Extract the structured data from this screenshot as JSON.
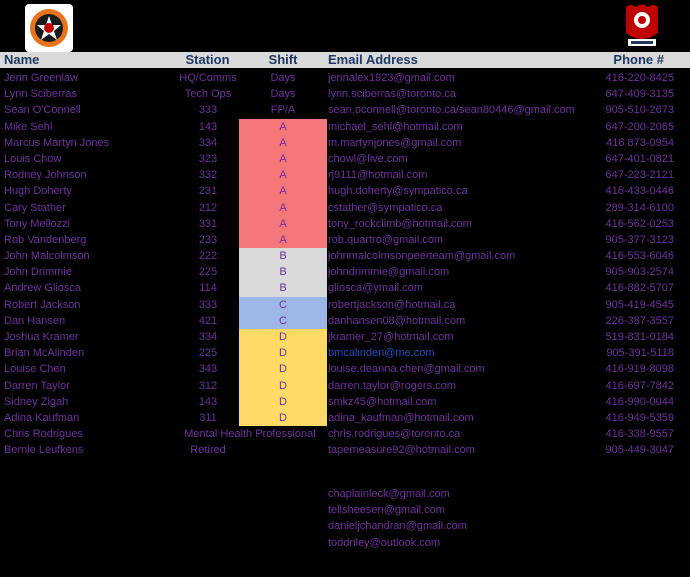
{
  "header": {
    "name": "Name",
    "station": "Station",
    "shift": "Shift",
    "email": "Email Address",
    "phone": "Phone #"
  },
  "colors": {
    "shift_a": "#f4777a",
    "shift_b": "#d9d9d9",
    "shift_c": "#9cb6e5",
    "shift_d": "#ffd966",
    "text": "#7030a0",
    "header_text": "#1f3864"
  },
  "rows": [
    {
      "name": "Jenn Greenlaw",
      "station": "HQ/Comms",
      "shift": "Days",
      "email": "jennalex1923@gmail.com",
      "phone": "416-220-8425"
    },
    {
      "name": "Lynn Sciberras",
      "station": "Tech Ops",
      "shift": "Days",
      "email": "lynn.sciberras@toronto.ca",
      "phone": "647-409-3135"
    },
    {
      "name": "Sean O'Connell",
      "station": "333",
      "shift": "FP/A",
      "email": "sean.oconnell@toronto.ca/sean80446@gmail.com",
      "phone": "905-510-2673"
    },
    {
      "name": "Mike Sehl",
      "station": "143",
      "shift": "A",
      "email": "michael_sehl@hotmail.com",
      "phone": "647-200-2065"
    },
    {
      "name": "Marcus Martyn Jones",
      "station": "334",
      "shift": "A",
      "email": "m.martynjones@gmail.com",
      "phone": "416 873-0954"
    },
    {
      "name": "Louis Chow",
      "station": "323",
      "shift": "A",
      "email": "chowl@live.com",
      "phone": "647-401-0821"
    },
    {
      "name": "Rodney Johnson",
      "station": "332",
      "shift": "A",
      "email": "rj9111@hotmail.com",
      "phone": "647-223-2121"
    },
    {
      "name": "Hugh Doherty",
      "station": "231",
      "shift": "A",
      "email": "hugh.doherty@sympatico.ca",
      "phone": "416-433-0446"
    },
    {
      "name": "Cary Stather",
      "station": "212",
      "shift": "A",
      "email": "cstather@sympatico.ca",
      "phone": "289-314-6100"
    },
    {
      "name": "Tony Mellozzi",
      "station": "331",
      "shift": "A",
      "email": "tony_rockclimb@hotmail.com",
      "phone": "416-562-0253"
    },
    {
      "name": "Rob Vandenberg",
      "station": "233",
      "shift": "A",
      "email": "rob.quartro@gmail.com",
      "phone": "905-377-3123"
    },
    {
      "name": "John Malcolmson",
      "station": "222",
      "shift": "B",
      "email": "johnmalcolmsonpeerteam@gmail.com",
      "phone": "416-553-6046"
    },
    {
      "name": "John Drimmie",
      "station": "225",
      "shift": "B",
      "email": "johndrimmie@gmail.com",
      "phone": "905-903-2574"
    },
    {
      "name": "Andrew Gliosca",
      "station": "114",
      "shift": "B",
      "email": "gliosca@ymail.com",
      "phone": "416-882-5707"
    },
    {
      "name": "Robert Jackson",
      "station": "333",
      "shift": "C",
      "email": "robertjackson@hotmail.ca",
      "phone": "905-419-4545"
    },
    {
      "name": "Dan Hansen",
      "station": "421",
      "shift": "C",
      "email": "danhansen08@hotmail.com",
      "phone": "226-387-3557"
    },
    {
      "name": "Joshua Kramer",
      "station": "334",
      "shift": "D",
      "email": "jkramer_27@hotmail.com",
      "phone": "519-831-0184"
    },
    {
      "name": "Brian McAlinden",
      "station": "225",
      "shift": "D",
      "email": "bmcalinden@me.com",
      "phone": "905-391-5118"
    },
    {
      "name": "Louise Chen",
      "station": "343",
      "shift": "D",
      "email": "louise.deanna.chen@gmail.com",
      "phone": "416-919-8098"
    },
    {
      "name": "Darren Taylor",
      "station": "312",
      "shift": "D",
      "email": "darren.taylor@rogers.com",
      "phone": "416-697-7842"
    },
    {
      "name": "Sidney Zigah",
      "station": "143",
      "shift": "D",
      "email": "smkz45@hotmail.com",
      "phone": "416-990-0044"
    },
    {
      "name": "Adina Kaufman",
      "station": "311",
      "shift": "D",
      "email": "adina_kaufman@hotmail.com",
      "phone": "416-949-5359"
    },
    {
      "name": "Chris Rodrigues",
      "station": "Mental Health Professional",
      "shift": "",
      "email": "chris.rodrigues@toronto.ca",
      "phone": "416-338-9557"
    },
    {
      "name": "Bernie Leufkens",
      "station": "Retired",
      "shift": "",
      "email": "tapemeasure92@hotmail.com",
      "phone": "905-449-3047"
    }
  ],
  "extra_emails": [
    "chaplainleck@gmail.com",
    "tellsheesen@gmail.com",
    "danieljchandran@gmail.com",
    "toddriley@outlook.com"
  ],
  "icons": {
    "left_logo": "fire-department-crest-icon",
    "right_logo": "toronto-fire-services-logo-icon"
  }
}
